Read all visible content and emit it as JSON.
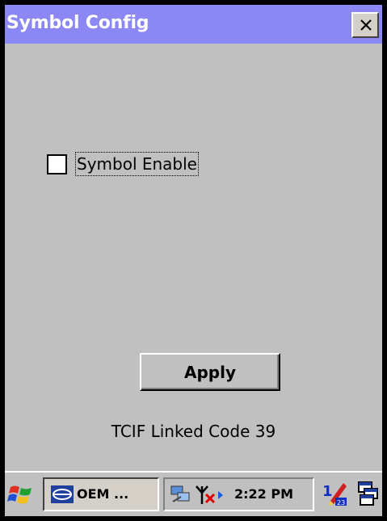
{
  "window": {
    "title": "Symbol Config",
    "close_icon": "close-icon"
  },
  "form": {
    "checkbox_label": "Symbol Enable",
    "checkbox_checked": false,
    "apply_label": "Apply",
    "status_text": "TCIF Linked Code 39"
  },
  "taskbar": {
    "start_icon": "windows-flag-icon",
    "task_label": "OEM ...",
    "task_icon": "app-icon",
    "clock": "2:22 PM",
    "tray_icons": [
      "network-icon",
      "signal-antenna-icon"
    ],
    "input_icon": "input-panel-icon",
    "desktop_icon": "show-desktop-icon"
  },
  "colors": {
    "titlebar": "#8b87f5",
    "background": "#c0c0c0"
  }
}
